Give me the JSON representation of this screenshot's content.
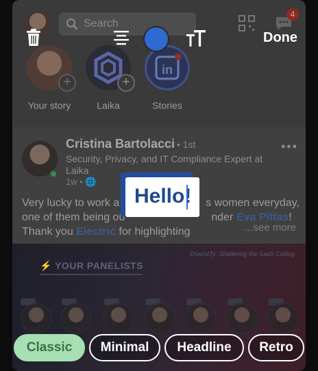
{
  "feed": {
    "search": {
      "label": "Search"
    },
    "notifications_count": "4",
    "stories": [
      {
        "label": "Your story"
      },
      {
        "label": "Laika"
      },
      {
        "label": "Stories"
      }
    ],
    "post": {
      "author_name": "Cristina Bartolacci",
      "author_degree": "• 1st",
      "author_headline": "Security, Privacy, and IT Compliance Expert at Laika",
      "meta": "1w • 🌐",
      "more_menu": "•••",
      "body_line1": "Very lucky to work a",
      "body_line1_end": "s women everyday,",
      "body_line2": "one of them being ou",
      "body_line2_mid": "nder ",
      "body_link1": "Eva Pittas",
      "body_line2_end": "!",
      "body_line3": "Thank you ",
      "body_link2": "Electric",
      "body_line3_end": " for highlighting",
      "see_more": "...see more"
    },
    "banner": {
      "caption": "DiversITy: Shattering the SaaS Ceiling",
      "title": "⚡ YOUR PANELISTS"
    }
  },
  "editor": {
    "done_label": "Done",
    "color_accent": "#2f6ad3",
    "sticker_text": "Hello!",
    "styles": [
      {
        "label": "Classic",
        "active": true
      },
      {
        "label": "Minimal",
        "active": false
      },
      {
        "label": "Headline",
        "active": false
      },
      {
        "label": "Retro",
        "active": false
      }
    ]
  }
}
